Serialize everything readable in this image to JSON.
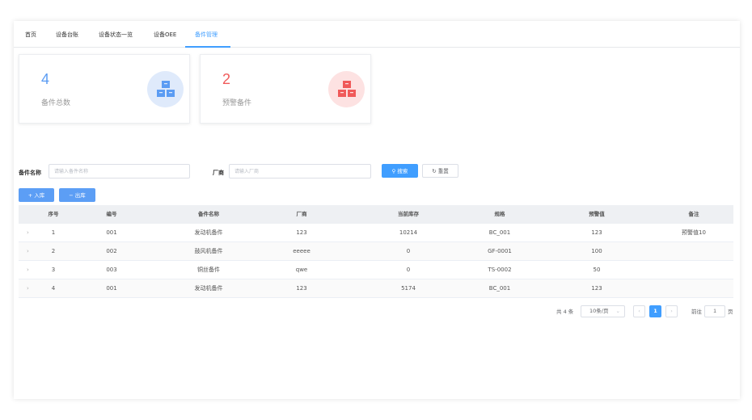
{
  "tabs": [
    {
      "label": "首页"
    },
    {
      "label": "设备台账"
    },
    {
      "label": "设备状态一览"
    },
    {
      "label": "设备OEE"
    },
    {
      "label": "备件管理"
    }
  ],
  "cards": [
    {
      "value": "4",
      "label": "备件总数",
      "color": "#5b9cf3",
      "bg": "#dfeafb",
      "icon": "boxes-icon"
    },
    {
      "value": "2",
      "label": "预警备件",
      "color": "#f05a5a",
      "bg": "#fde2e2",
      "icon": "boxes-icon"
    }
  ],
  "filters": {
    "name_label": "备件名称",
    "name_placeholder": "请输入备件名称",
    "vendor_label": "厂商",
    "vendor_placeholder": "请输入厂商",
    "search_label": "搜索",
    "reset_label": "重置"
  },
  "actions": {
    "stock_in_label": "入库",
    "stock_out_label": "出库"
  },
  "table": {
    "headers": [
      "序号",
      "编号",
      "备件名称",
      "厂商",
      "当前库存",
      "规格",
      "预警值",
      "备注"
    ],
    "rows": [
      [
        "1",
        "001",
        "发动机备件",
        "123",
        "10214",
        "BC_001",
        "123",
        "预警值10"
      ],
      [
        "2",
        "002",
        "鼓风机备件",
        "eeeee",
        "0",
        "GF-0001",
        "100",
        ""
      ],
      [
        "3",
        "003",
        "铜丝备件",
        "qwe",
        "0",
        "TS-0002",
        "50",
        ""
      ],
      [
        "4",
        "001",
        "发动机备件",
        "123",
        "5174",
        "BC_001",
        "123",
        ""
      ]
    ]
  },
  "pagination": {
    "total_text": "共 4 条",
    "page_size": "10条/页",
    "current_page": "1",
    "goto_label": "前往",
    "goto_value": "1",
    "page_suffix": "页"
  },
  "colors": {
    "accent": "#409eff"
  }
}
